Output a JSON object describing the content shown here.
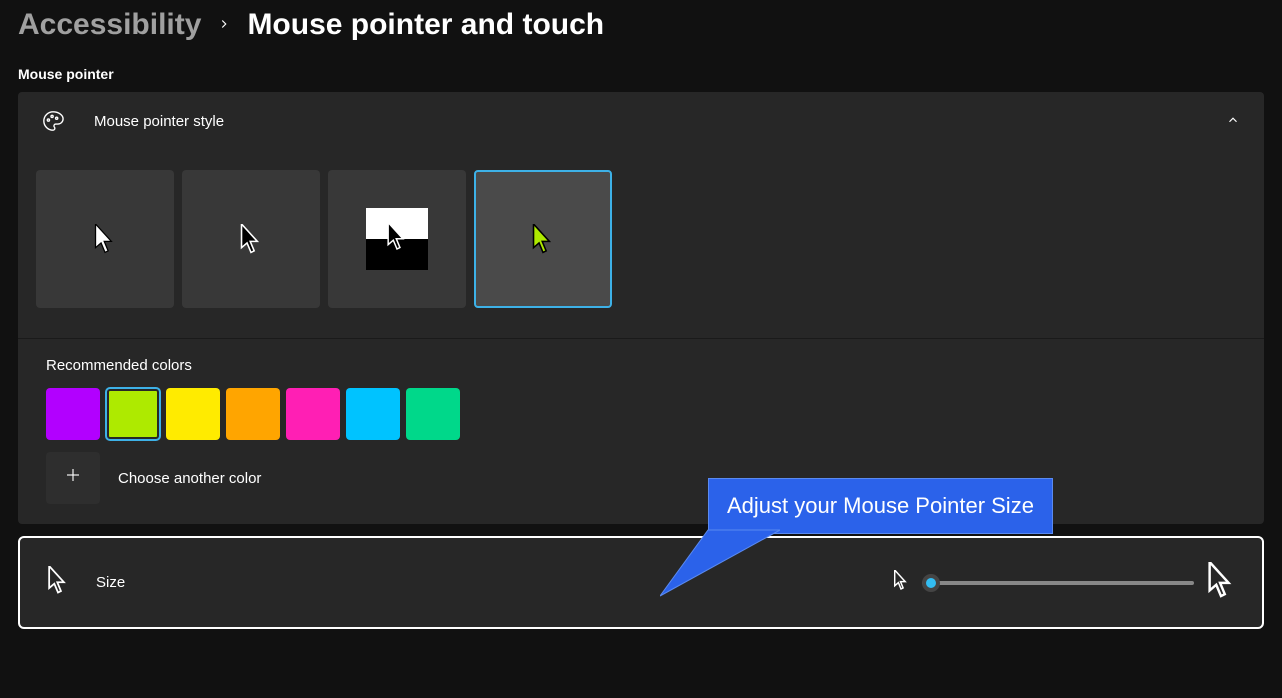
{
  "breadcrumb": {
    "parent": "Accessibility",
    "current": "Mouse pointer and touch"
  },
  "section_label": "Mouse pointer",
  "style_panel": {
    "title": "Mouse pointer style",
    "options": [
      {
        "id": "white",
        "selected": false
      },
      {
        "id": "black",
        "selected": false
      },
      {
        "id": "inverted",
        "selected": false
      },
      {
        "id": "custom",
        "selected": true
      }
    ]
  },
  "colors": {
    "label": "Recommended colors",
    "swatches": [
      {
        "color": "#B200FF",
        "selected": false
      },
      {
        "color": "#AEEA00",
        "selected": true
      },
      {
        "color": "#FFEB00",
        "selected": false
      },
      {
        "color": "#FFA500",
        "selected": false
      },
      {
        "color": "#FF1FB4",
        "selected": false
      },
      {
        "color": "#00C3FF",
        "selected": false
      },
      {
        "color": "#00D88A",
        "selected": false
      }
    ],
    "choose_label": "Choose another color"
  },
  "size": {
    "label": "Size"
  },
  "callout": {
    "text": "Adjust your Mouse Pointer Size"
  }
}
